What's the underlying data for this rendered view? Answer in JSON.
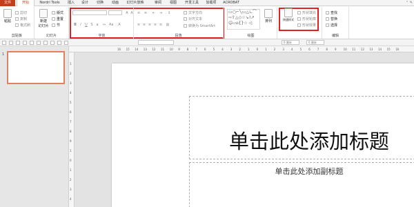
{
  "tabs": [
    "文件",
    "开始",
    "Nordri Tools",
    "插入",
    "设计",
    "切换",
    "动画",
    "幻灯片放映",
    "审阅",
    "视图",
    "开发工具",
    "加载项",
    "ACROBAT"
  ],
  "ribbon": {
    "clipboard": {
      "paste": "粘贴",
      "cut": "剪切",
      "copy": "复制",
      "format_painter": "格式刷",
      "label": "剪贴板"
    },
    "slides": {
      "new_slide": "新建\n幻灯片",
      "layout": "版式",
      "reset": "重置",
      "section": "节",
      "label": "幻灯片"
    },
    "font": {
      "label": "字体"
    },
    "paragraph": {
      "text_direction": "文字方向",
      "align_text": "对齐文本",
      "convert_smartart": "转换为 SmartArt",
      "label": "段落"
    },
    "drawing": {
      "arrange": "排列",
      "label": "绘图"
    },
    "quick_styles": {
      "label": "快速样式"
    },
    "shape_fill": "形状填充",
    "shape_outline": "形状轮廓",
    "shape_effects": "形状效果",
    "editing": {
      "find": "查找",
      "replace": "替换",
      "select": "选择",
      "label": "编辑"
    }
  },
  "qat": {
    "combo1": "",
    "combo2": "0 厘米",
    "combo3": "0 厘米"
  },
  "ruler": {
    "ticks": [
      "16",
      "15",
      "14",
      "13",
      "12",
      "11",
      "10",
      "9",
      "8",
      "7",
      "6",
      "5",
      "4",
      "3",
      "2",
      "1",
      "0",
      "1",
      "2",
      "3",
      "4",
      "5",
      "6",
      "7",
      "8",
      "9",
      "10",
      "11",
      "12",
      "13",
      "14",
      "15",
      "16"
    ]
  },
  "vruler": {
    "ticks": [
      "1",
      "2",
      "3",
      "4",
      "5",
      "6",
      "7",
      "8",
      "9",
      "1",
      "0",
      "1",
      "2",
      "3",
      "4"
    ]
  },
  "thumbs": {
    "num": "1"
  },
  "slide": {
    "title_placeholder": "单击此处添加标题",
    "subtitle_placeholder": "单击此处添加副标题"
  },
  "colors": {
    "accent": "#c43e1c",
    "highlight": "#e02020",
    "thumb_border": "#e08060"
  }
}
